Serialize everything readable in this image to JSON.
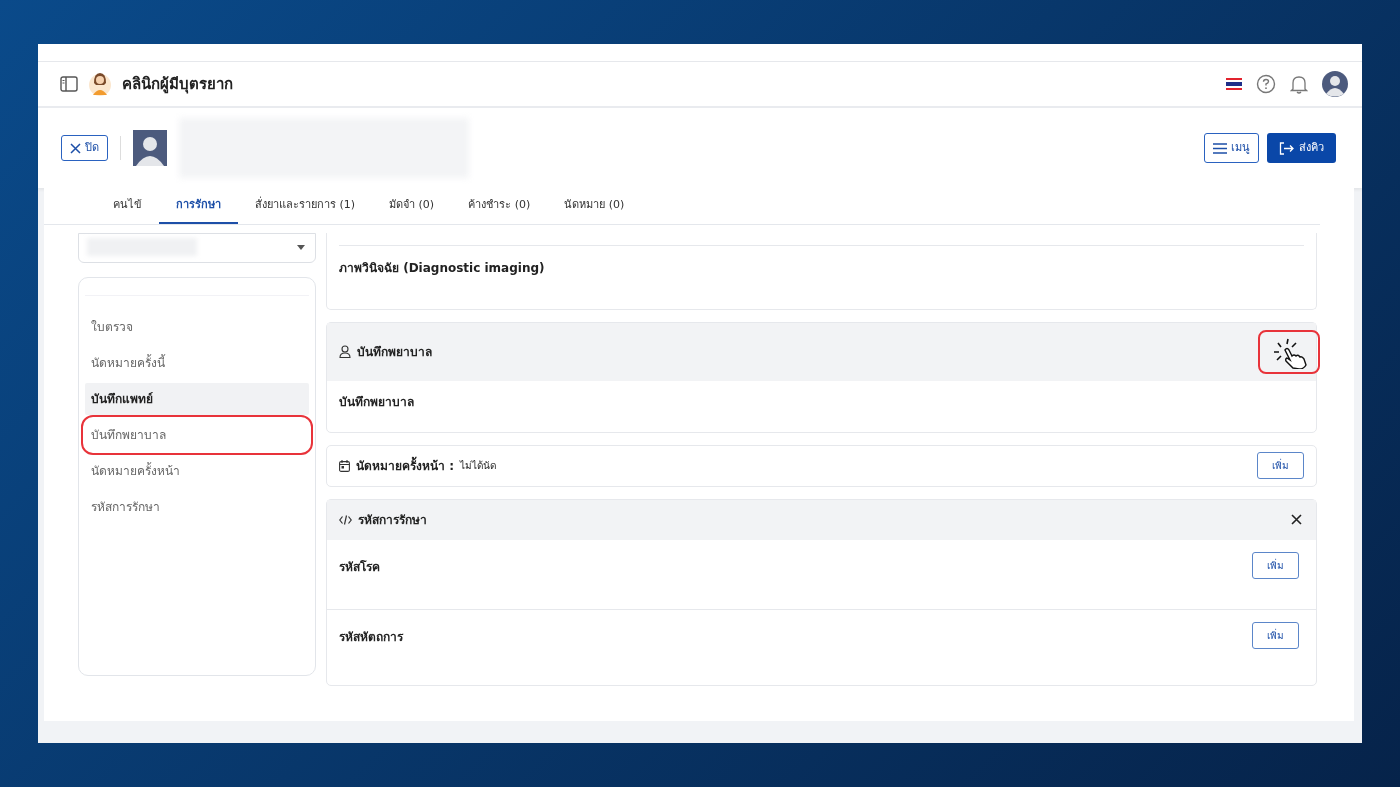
{
  "app": {
    "title": "คลินิกผู้มีบุตรยาก"
  },
  "patient_bar": {
    "close_button": "ปิด",
    "menu_button": "เมนู",
    "send_button": "ส่งคิว"
  },
  "tabs": [
    {
      "label": "คนไข้",
      "selected": false
    },
    {
      "label": "การรักษา",
      "selected": true
    },
    {
      "label": "สั่งยาและรายการ (1)",
      "selected": false
    },
    {
      "label": "มัดจำ (0)",
      "selected": false
    },
    {
      "label": "ค้างชำระ (0)",
      "selected": false
    },
    {
      "label": "นัดหมาย (0)",
      "selected": false
    }
  ],
  "sidebar": {
    "items": [
      {
        "label": "ใบตรวจ",
        "selected": false,
        "callout": false
      },
      {
        "label": "นัดหมายครั้งนี้",
        "selected": false,
        "callout": false
      },
      {
        "label": "บันทึกแพทย์",
        "selected": true,
        "callout": false
      },
      {
        "label": "บันทึกพยาบาล",
        "selected": false,
        "callout": true
      },
      {
        "label": "นัดหมายครั้งหน้า",
        "selected": false,
        "callout": false
      },
      {
        "label": "รหัสการรักษา",
        "selected": false,
        "callout": false
      }
    ]
  },
  "sections": [
    {
      "kind": "plain",
      "title": "ภาพวินิจฉัย (Diagnostic imaging)"
    },
    {
      "kind": "note",
      "header": "บันทึกพยาบาล",
      "body": "บันทึกพยาบาล",
      "callout": true
    },
    {
      "kind": "appointment",
      "label": "นัดหมายครั้งหน้า :",
      "value": "ไม่ได้นัด",
      "button": "เพิ่ม"
    },
    {
      "kind": "codes",
      "header": "รหัสการรักษา",
      "rows": [
        {
          "label": "รหัสโรค",
          "button": "เพิ่ม"
        },
        {
          "label": "รหัสหัตถการ",
          "button": "เพิ่ม"
        }
      ]
    }
  ]
}
